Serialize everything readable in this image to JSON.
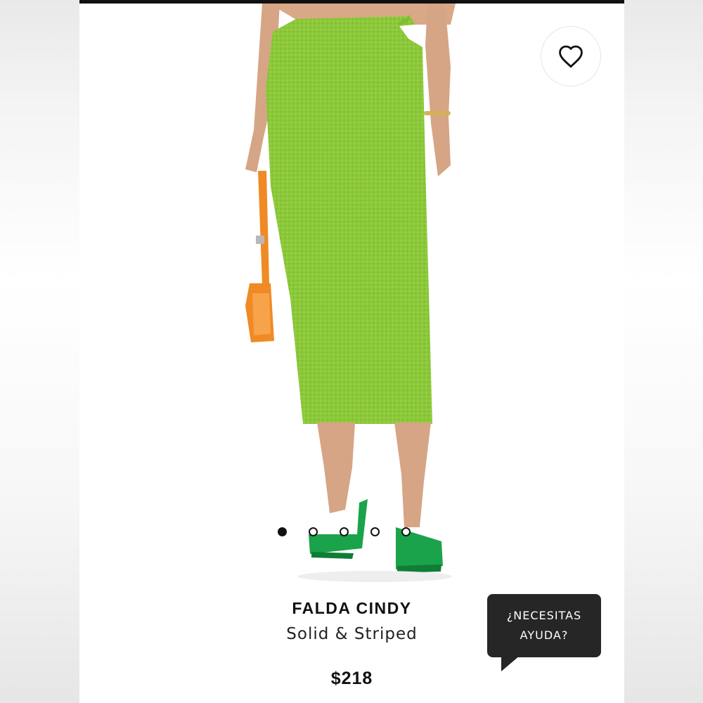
{
  "product": {
    "title": "FALDA CINDY",
    "brand": "Solid & Striped",
    "price": "$218"
  },
  "favorite": {
    "icon": "heart-icon"
  },
  "gallery": {
    "image_count": 5,
    "active_index": 0
  },
  "help": {
    "line1": "¿NECESITAS",
    "line2": "AYUDA?"
  },
  "colors": {
    "skirt": "#8bc83a",
    "shoes": "#1aa34a",
    "bag": "#f08a24",
    "help_bubble": "#262626",
    "page_bg": "#ffffff"
  }
}
